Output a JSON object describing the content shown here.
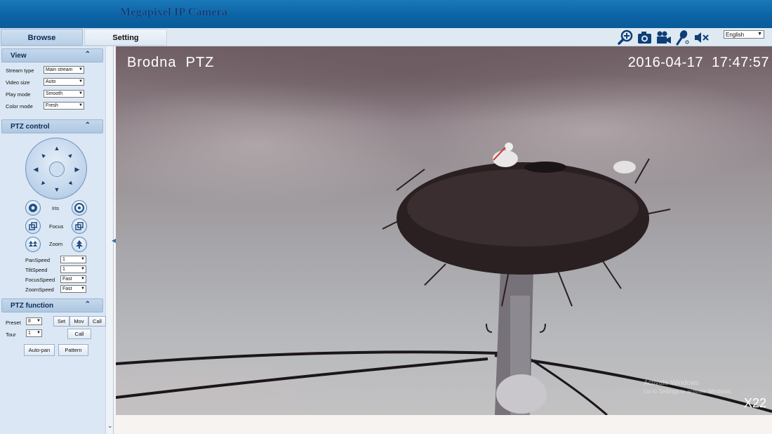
{
  "header": {
    "title": "Megapixel IP Camera"
  },
  "tabs": {
    "browse": "Browse",
    "setting": "Setting"
  },
  "toolbar": {
    "icons": [
      "zoom-in-icon",
      "snapshot-camera-icon",
      "record-video-icon",
      "microphone-icon",
      "speaker-mute-icon"
    ],
    "language": "English"
  },
  "view": {
    "title": "View",
    "rows": [
      {
        "label": "Stream type",
        "value": "Main stream"
      },
      {
        "label": "Video size",
        "value": "Auto"
      },
      {
        "label": "Play mode",
        "value": "Smooth"
      },
      {
        "label": "Color mode",
        "value": "Fresh"
      }
    ]
  },
  "ptz_control": {
    "title": "PTZ control",
    "iris": "Iris",
    "focus": "Focus",
    "zoom": "Zoom",
    "speeds": [
      {
        "label": "PanSpeed",
        "value": "1"
      },
      {
        "label": "TiltSpeed",
        "value": "1"
      },
      {
        "label": "FocusSpeed",
        "value": "Fast"
      },
      {
        "label": "ZoomSpeed",
        "value": "Fast"
      }
    ]
  },
  "ptz_function": {
    "title": "PTZ function",
    "preset_label": "Preset",
    "preset_value": "8",
    "tour_label": "Tour",
    "tour_value": "1",
    "set": "Set",
    "mov": "Mov",
    "call": "Call",
    "tour_call": "Call",
    "auto_pan": "Auto-pan",
    "pattern": "Pattern"
  },
  "video": {
    "title": "Brodna  PTZ",
    "timestamp": "2016-04-17  17:47:57",
    "zoom": "X22",
    "watermark_line1": "Activate Windows",
    "watermark_line2": "Go to Settings to activate Windows."
  }
}
